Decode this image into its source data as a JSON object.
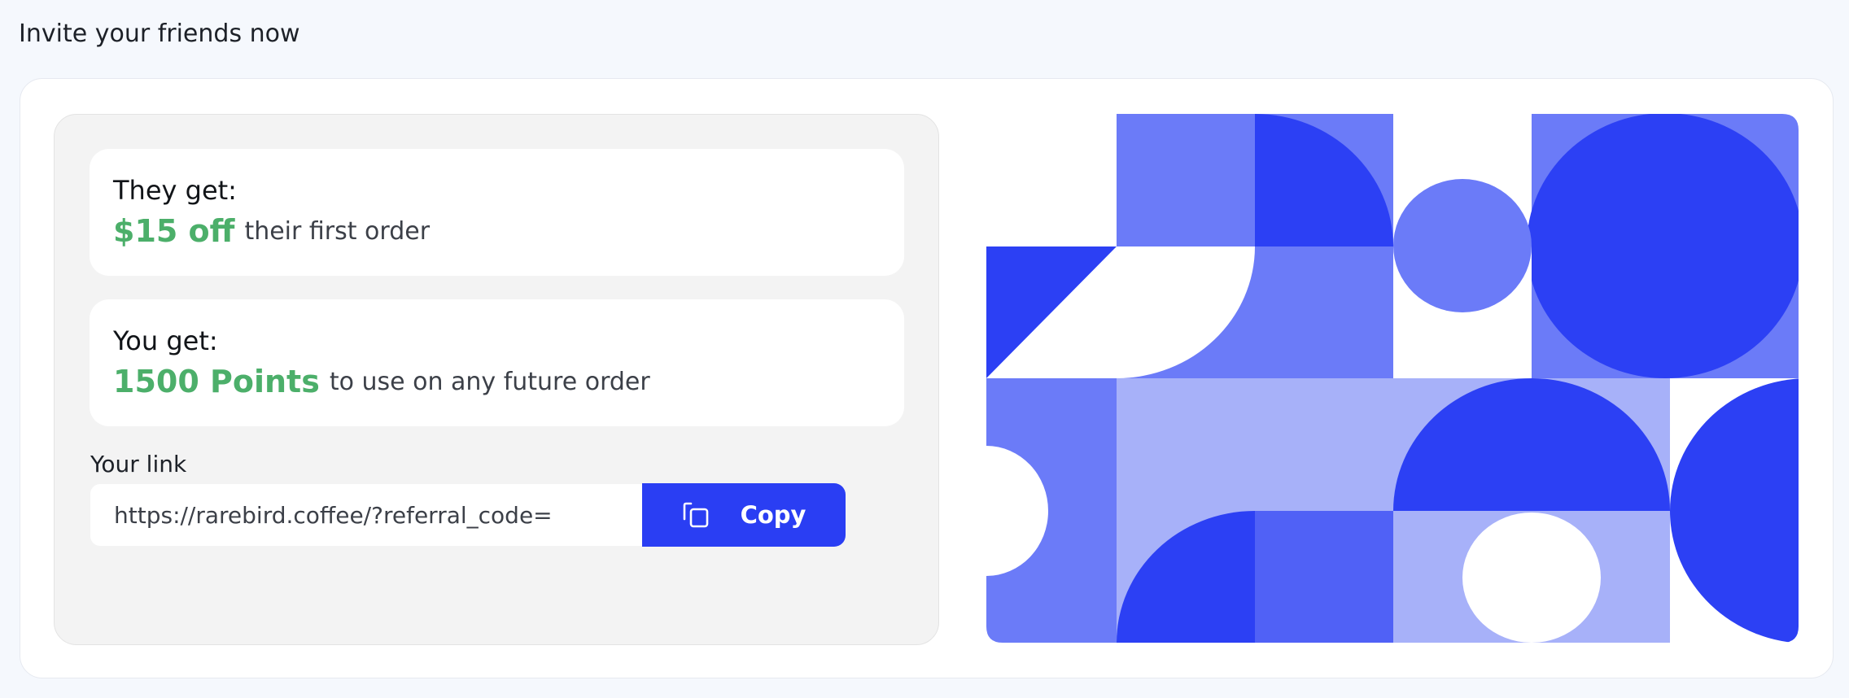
{
  "page": {
    "title": "Invite your friends now"
  },
  "they_get": {
    "title": "They get:",
    "amount": "$15 off",
    "description": "their first order"
  },
  "you_get": {
    "title": "You get:",
    "amount": "1500 Points",
    "description": "to use on any future order"
  },
  "referral_link": {
    "label": "Your link",
    "value": "https://rarebird.coffee/?referral_code=",
    "copy_label": "Copy",
    "copy_icon": "copy-icon"
  },
  "colors": {
    "accent_blue": "#2a3ef3",
    "highlight_green": "#4caf6a",
    "art_blue_dark": "#2c40f4",
    "art_blue_mid": "#6b7bf8",
    "art_blue_medium": "#5061f6",
    "art_blue_light": "#a7b1f9"
  }
}
